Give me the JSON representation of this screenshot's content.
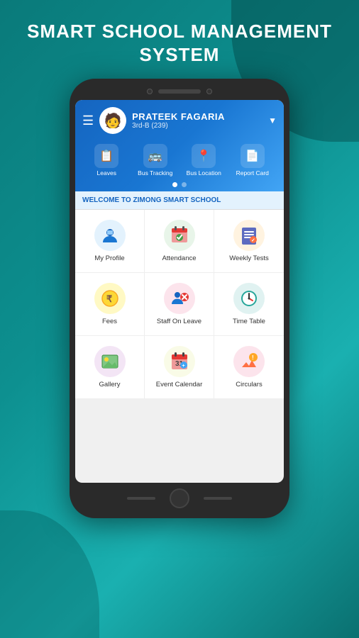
{
  "page": {
    "title_line1": "SMART SCHOOL MANAGEMENT",
    "title_line2": "SYSTEM"
  },
  "app": {
    "header": {
      "user_name": "PRATEEK FAGARIA",
      "user_sub": "3rd-B (239)",
      "nav_items": [
        {
          "icon": "📋",
          "label": "Leaves"
        },
        {
          "icon": "🚌",
          "label": "Bus Tracking"
        },
        {
          "icon": "📍",
          "label": "Bus Location"
        },
        {
          "icon": "📄",
          "label": "Report Card"
        }
      ],
      "dot_active": 0
    },
    "welcome_text": "WELCOME TO ZIMONG SMART SCHOOL",
    "menu_items": [
      {
        "icon": "👔",
        "label": "My Profile",
        "color": "blue"
      },
      {
        "icon": "📅",
        "label": "Attendance",
        "color": "green"
      },
      {
        "icon": "📝",
        "label": "Weekly Tests",
        "color": "orange"
      },
      {
        "icon": "💰",
        "label": "Fees",
        "color": "yellow"
      },
      {
        "icon": "🧑‍💼",
        "label": "Staff On Leave",
        "color": "red"
      },
      {
        "icon": "🗓️",
        "label": "Time Table",
        "color": "teal"
      },
      {
        "icon": "🖼️",
        "label": "Gallery",
        "color": "purple"
      },
      {
        "icon": "📆",
        "label": "Event Calendar",
        "color": "lime"
      },
      {
        "icon": "📢",
        "label": "Circulars",
        "color": "pink"
      }
    ]
  }
}
